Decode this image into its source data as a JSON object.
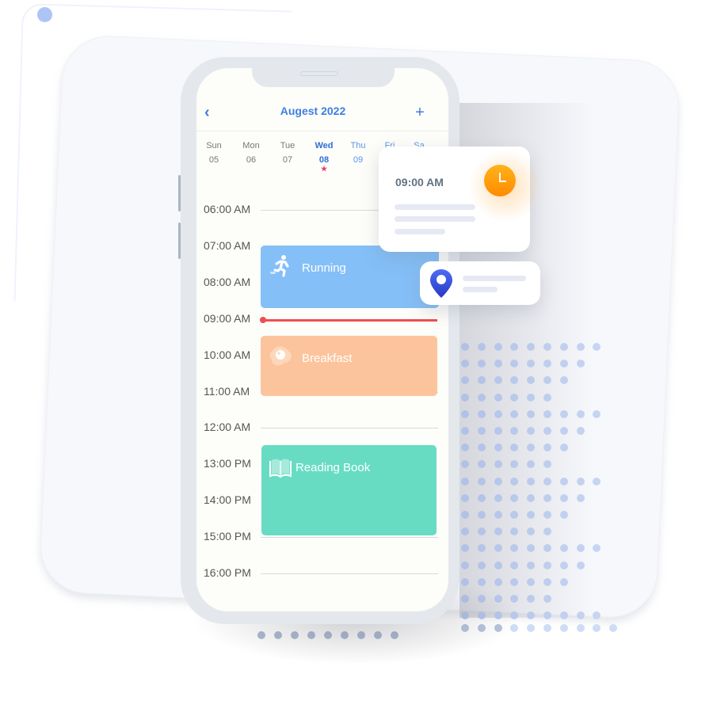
{
  "calendar": {
    "back_icon": "chevron-left-icon",
    "back_glyph": "‹",
    "month_title": "Augest 2022",
    "add_glyph": "+",
    "week": [
      {
        "name": "Sun",
        "num": "05",
        "state": "past"
      },
      {
        "name": "Mon",
        "num": "06",
        "state": "past"
      },
      {
        "name": "Tue",
        "num": "07",
        "state": "past"
      },
      {
        "name": "Wed",
        "num": "08",
        "state": "selected",
        "marker": "★"
      },
      {
        "name": "Thu",
        "num": "09",
        "state": "upcoming"
      },
      {
        "name": "Fri",
        "num": "",
        "state": "upcoming"
      },
      {
        "name": "Sa",
        "num": "",
        "state": "upcoming"
      }
    ],
    "hours": [
      "06:00 AM",
      "07:00 AM",
      "08:00 AM",
      "09:00 AM",
      "10:00 AM",
      "11:00 AM",
      "12:00 AM",
      "13:00 PM",
      "14:00 PM",
      "15:00 PM",
      "16:00 PM"
    ],
    "current_time_indicator": "09:00 AM",
    "events": [
      {
        "title": "Running",
        "icon": "running-person-icon",
        "color": "#84bff7",
        "start": "07:00 AM",
        "end": "08:30 AM"
      },
      {
        "title": "Breakfast",
        "icon": "fried-egg-icon",
        "color": "#fcc49c",
        "start": "09:15 AM",
        "end": "10:45 AM"
      },
      {
        "title": "Reading Book",
        "icon": "open-book-icon",
        "color": "#67dcc3",
        "start": "12:15 PM",
        "end": "14:45 PM"
      }
    ]
  },
  "time_card": {
    "time": "09:00 AM",
    "icon": "clock-icon",
    "accent": "#ff9a0a"
  },
  "location_card": {
    "icon": "location-pin-icon",
    "accent": "#3b54e0"
  },
  "colors": {
    "accent": "#3d7ee0",
    "now_line": "#ee4e52",
    "selected_marker": "#e8436b"
  }
}
